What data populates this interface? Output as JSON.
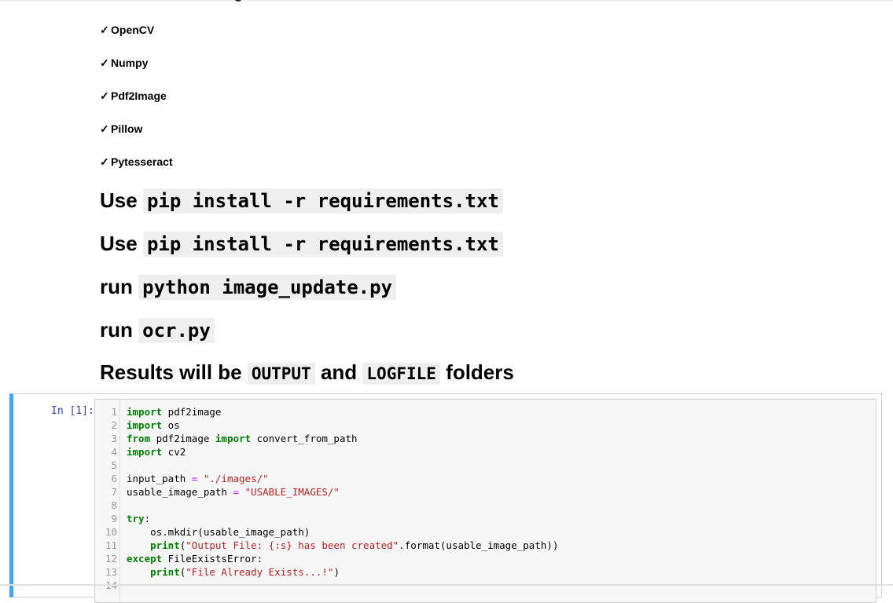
{
  "requirements": [
    "OpenCV",
    "Numpy",
    "Pdf2Image",
    "Pillow",
    "Pytesseract"
  ],
  "check_glyph": "✓",
  "headings": {
    "h1": {
      "prefix": "Use",
      "code": "pip install -r requirements.txt"
    },
    "h2": {
      "prefix": "Use",
      "code": "pip install -r requirements.txt"
    },
    "h3": {
      "prefix": "run",
      "code": "python image_update.py"
    },
    "h4": {
      "prefix": "run",
      "code": "ocr.py"
    },
    "h5": {
      "prefix": "Results will be",
      "code1": "OUTPUT",
      "mid": "and",
      "code2": "LOGFILE",
      "suffix": "folders"
    }
  },
  "cell": {
    "prompt": "In [1]:",
    "accent_color": "#42a5f5",
    "lines": [
      {
        "n": "1",
        "parts": [
          {
            "t": "import",
            "c": "kw"
          },
          {
            "t": " pdf2image",
            "c": "nm"
          }
        ]
      },
      {
        "n": "2",
        "parts": [
          {
            "t": "import",
            "c": "kw"
          },
          {
            "t": " os",
            "c": "nm"
          }
        ]
      },
      {
        "n": "3",
        "parts": [
          {
            "t": "from",
            "c": "kw"
          },
          {
            "t": " pdf2image ",
            "c": "nm"
          },
          {
            "t": "import",
            "c": "kw"
          },
          {
            "t": " convert_from_path",
            "c": "nm"
          }
        ]
      },
      {
        "n": "4",
        "parts": [
          {
            "t": "import",
            "c": "kw"
          },
          {
            "t": " cv2",
            "c": "nm"
          }
        ]
      },
      {
        "n": "5",
        "parts": []
      },
      {
        "n": "6",
        "parts": [
          {
            "t": "input_path ",
            "c": "nm"
          },
          {
            "t": "=",
            "c": "op"
          },
          {
            "t": " ",
            "c": "nm"
          },
          {
            "t": "\"./images/\"",
            "c": "str"
          }
        ]
      },
      {
        "n": "7",
        "parts": [
          {
            "t": "usable_image_path ",
            "c": "nm"
          },
          {
            "t": "=",
            "c": "op"
          },
          {
            "t": " ",
            "c": "nm"
          },
          {
            "t": "\"USABLE_IMAGES/\"",
            "c": "str"
          }
        ]
      },
      {
        "n": "8",
        "parts": []
      },
      {
        "n": "9",
        "parts": [
          {
            "t": "try",
            "c": "kw"
          },
          {
            "t": ":",
            "c": "nm"
          }
        ]
      },
      {
        "n": "10",
        "parts": [
          {
            "t": "    os.mkdir(usable_image_path)",
            "c": "nm"
          }
        ]
      },
      {
        "n": "11",
        "parts": [
          {
            "t": "    ",
            "c": "nm"
          },
          {
            "t": "print",
            "c": "kw"
          },
          {
            "t": "(",
            "c": "nm"
          },
          {
            "t": "\"Output File: {:s} has been created\"",
            "c": "str"
          },
          {
            "t": ".format(usable_image_path))",
            "c": "nm"
          }
        ]
      },
      {
        "n": "12",
        "parts": [
          {
            "t": "except",
            "c": "kw"
          },
          {
            "t": " FileExistsError:",
            "c": "nm"
          }
        ]
      },
      {
        "n": "13",
        "parts": [
          {
            "t": "    ",
            "c": "nm"
          },
          {
            "t": "print",
            "c": "kw"
          },
          {
            "t": "(",
            "c": "nm"
          },
          {
            "t": "\"File Already Exists...!\"",
            "c": "str"
          },
          {
            "t": ")",
            "c": "nm"
          }
        ]
      },
      {
        "n": "14",
        "parts": []
      }
    ]
  }
}
